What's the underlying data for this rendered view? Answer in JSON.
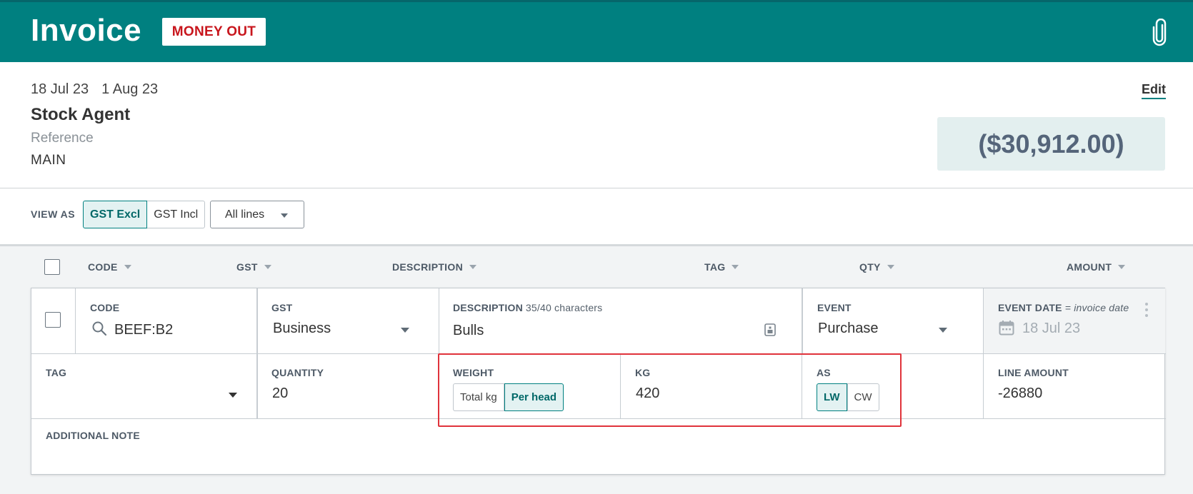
{
  "topbar": {
    "title": "Invoice",
    "badge": "MONEY OUT",
    "attach_icon": "paperclip-icon",
    "color": "#008080"
  },
  "header": {
    "date": "18 Jul 23",
    "due_date": "1 Aug 23",
    "contact": "Stock Agent",
    "reference_label": "Reference",
    "reference_value": "MAIN",
    "edit_label": "Edit",
    "total": "($30,912.00)"
  },
  "viewbar": {
    "view_as_label": "VIEW AS",
    "options": [
      "GST Excl",
      "GST Incl"
    ],
    "selected": "GST Excl",
    "lines_filter": "All lines"
  },
  "columns": [
    "CODE",
    "GST",
    "DESCRIPTION",
    "TAG",
    "QTY",
    "AMOUNT"
  ],
  "line": {
    "code_label": "CODE",
    "code_value": "BEEF:B2",
    "gst_label": "GST",
    "gst_value": "Business",
    "description_label": "DESCRIPTION",
    "description_counter": "35/40 characters",
    "description_value": "Bulls",
    "event_label": "EVENT",
    "event_value": "Purchase",
    "event_date_label": "EVENT DATE",
    "event_date_hint": "= invoice date",
    "event_date_value": "18 Jul 23",
    "tag_label": "TAG",
    "tag_value": "",
    "quantity_label": "QUANTITY",
    "quantity_value": "20",
    "weight_label": "WEIGHT",
    "weight_options": [
      "Total kg",
      "Per head"
    ],
    "weight_selected": "Per head",
    "kg_label": "KG",
    "kg_value": "420",
    "as_label": "AS",
    "as_options": [
      "LW",
      "CW"
    ],
    "as_selected": "LW",
    "line_amount_label": "LINE AMOUNT",
    "line_amount_value": "-26880",
    "note_label": "ADDITIONAL NOTE"
  }
}
